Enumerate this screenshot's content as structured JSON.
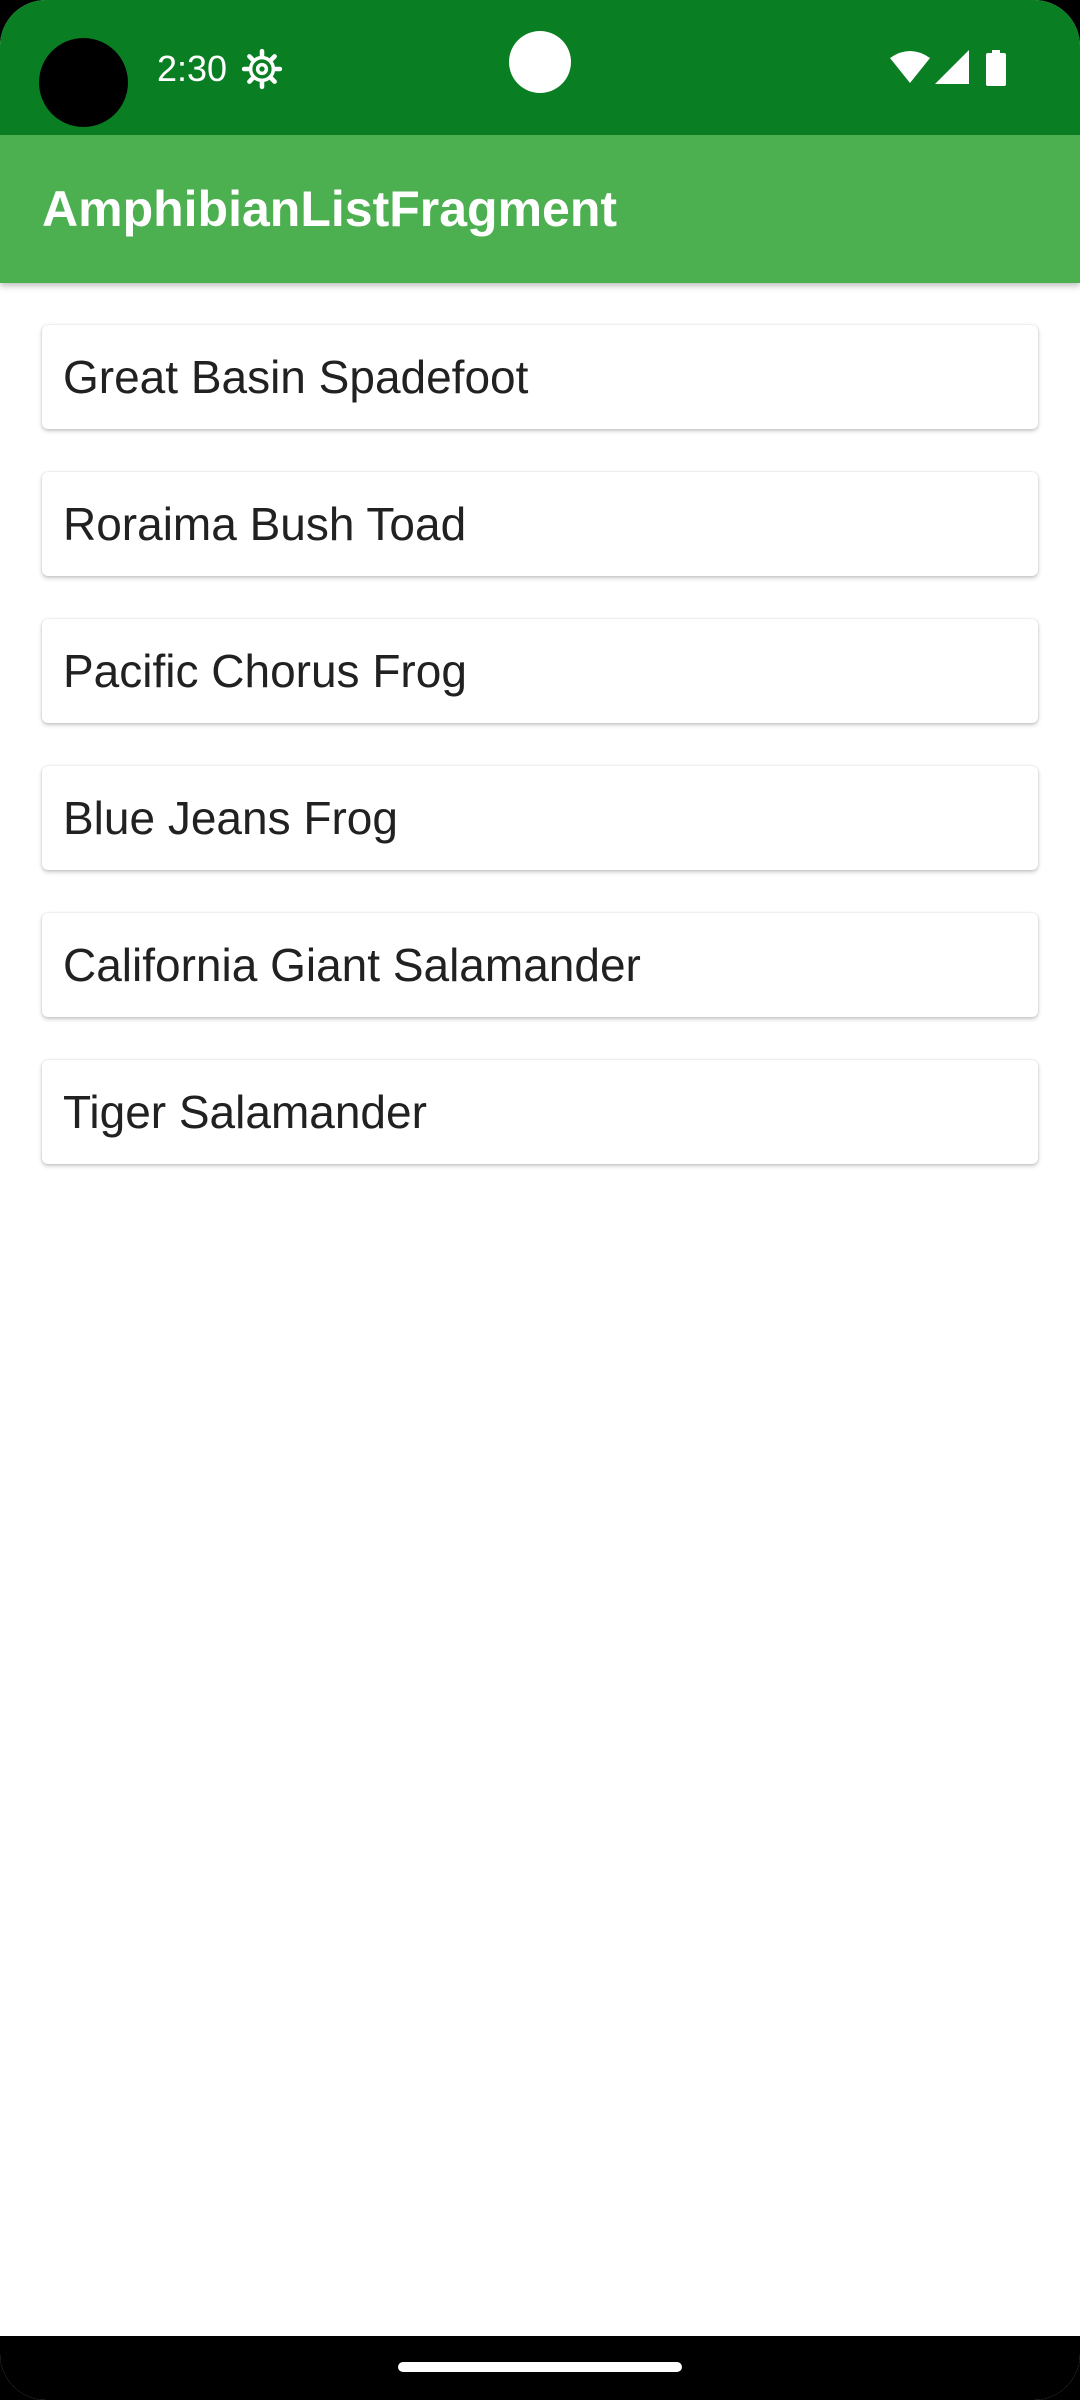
{
  "status_bar": {
    "time": "2:30",
    "icons": [
      "settings-icon",
      "wifi-icon",
      "cell-signal-icon",
      "battery-icon"
    ],
    "color": "#0a7e22"
  },
  "app_bar": {
    "title": "AmphibianListFragment",
    "color": "#4caf50"
  },
  "amphibians": [
    "Great Basin Spadefoot",
    "Roraima Bush Toad",
    "Pacific Chorus Frog",
    "Blue Jeans Frog",
    "California Giant Salamander",
    "Tiger Salamander"
  ]
}
